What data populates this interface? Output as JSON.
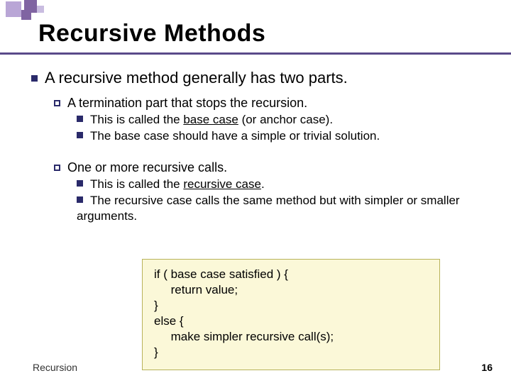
{
  "title": "Recursive Methods",
  "lvl1": "A recursive method generally has two parts.",
  "sec1": {
    "head": "A termination part that stops the recursion.",
    "p1_a": "This is called the ",
    "p1_u": "base case",
    "p1_b": " (or anchor case).",
    "p2": "The base case should have a simple or trivial solution."
  },
  "sec2": {
    "head": "One or more recursive calls.",
    "p1_a": "This is called the ",
    "p1_u": "recursive case",
    "p1_b": ".",
    "p2": "The recursive case calls the same method but with simpler or smaller arguments."
  },
  "code": {
    "l1": "if ( base case satisfied ) {",
    "l2": "     return value;",
    "l3": "}",
    "l4": "else {",
    "l5": "     make simpler recursive call(s);",
    "l6": "}"
  },
  "footer": {
    "left": "Recursion",
    "right": "16"
  }
}
